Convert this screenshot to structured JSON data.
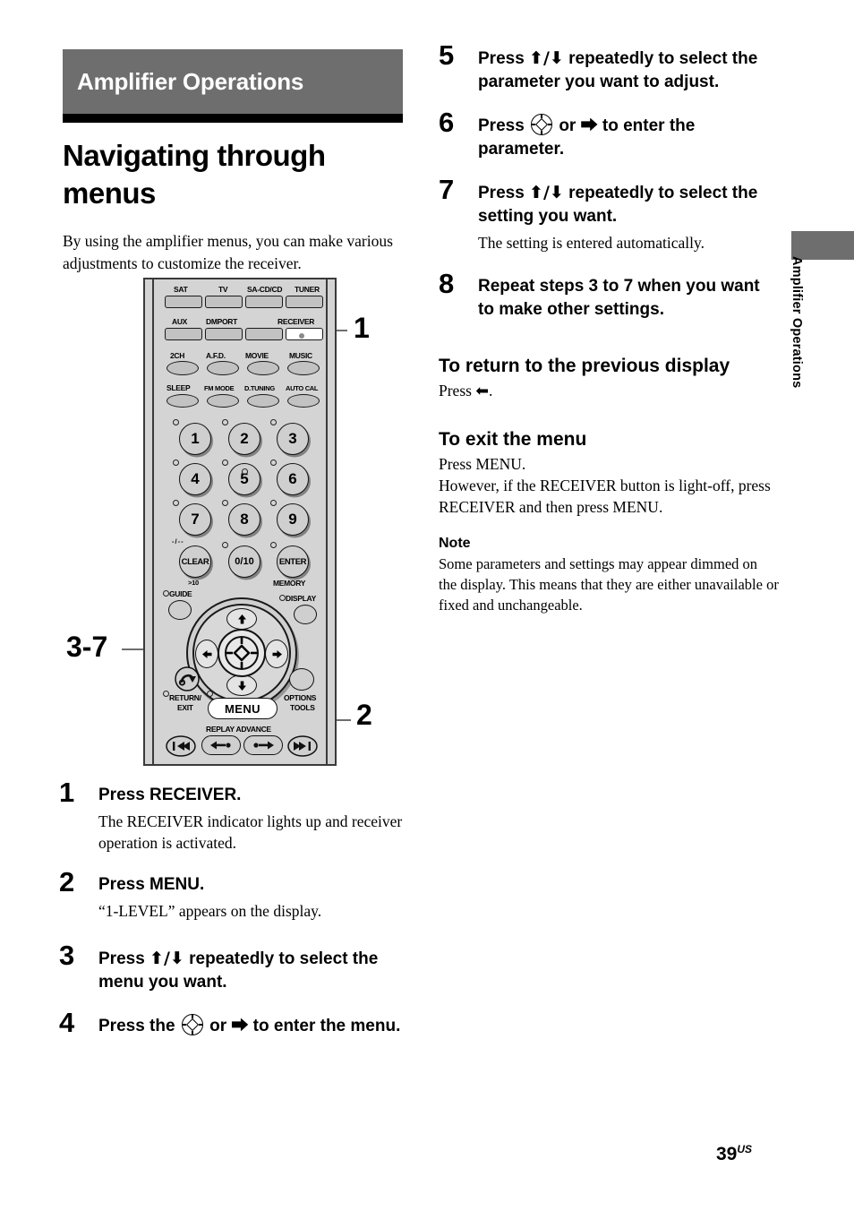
{
  "section": {
    "banner_title": "Amplifier Operations",
    "page_title": "Navigating through menus",
    "intro": "By using the amplifier menus, you can make various adjustments to customize the receiver."
  },
  "remote": {
    "callouts": [
      {
        "label": "1"
      },
      {
        "label": "2"
      },
      {
        "label": "3-7"
      }
    ],
    "input_row_1": [
      "SAT",
      "TV",
      "SA-CD/CD",
      "TUNER"
    ],
    "input_row_2": [
      "AUX",
      "DMPORT",
      "RECEIVER"
    ],
    "mode_row_1": [
      "2CH",
      "A.F.D.",
      "MOVIE",
      "MUSIC"
    ],
    "mode_row_2": [
      "SLEEP",
      "FM MODE",
      "D.TUNING",
      "AUTO CAL"
    ],
    "numeric_keys": [
      "1",
      "2",
      "3",
      "4",
      "5",
      "6",
      "7",
      "8",
      "9"
    ],
    "bottom_keys": [
      "CLEAR",
      "0/10",
      "ENTER"
    ],
    "key_sub_labels": {
      "clear_top": "-/--",
      "clear_bottom": ">10",
      "enter_bottom": "MEMORY"
    },
    "small_buttons": [
      "GUIDE",
      "DISPLAY"
    ],
    "nav_buttons": [
      "RETURN/ EXIT",
      "MENU",
      "OPTIONS TOOLS"
    ],
    "return_exit_line1": "RETURN/",
    "return_exit_line2": "EXIT",
    "options_line1": "OPTIONS",
    "options_line2": "TOOLS",
    "menu_label": "MENU",
    "replay_label": "REPLAY ADVANCE"
  },
  "steps_left": [
    {
      "num": "1",
      "title": "Press RECEIVER.",
      "desc": "The RECEIVER indicator lights up and receiver operation is activated."
    },
    {
      "num": "2",
      "title": "Press MENU.",
      "desc": "“1-LEVEL” appears on the display."
    },
    {
      "num": "3",
      "title_pre": "Press ",
      "title_arrows": "⬆/⬇",
      "title_post": " repeatedly to select the menu you want.",
      "desc": ""
    },
    {
      "num": "4",
      "title_pre": "Press the ",
      "title_post": " or ⮕ to enter the menu.",
      "desc": ""
    }
  ],
  "steps_right": [
    {
      "num": "5",
      "title_pre": "Press ",
      "title_arrows": "⬆/⬇",
      "title_post": " repeatedly to select the parameter you want to adjust.",
      "desc": ""
    },
    {
      "num": "6",
      "title_pre": "Press ",
      "title_post": " or ⮕ to enter the parameter.",
      "desc": ""
    },
    {
      "num": "7",
      "title_pre": "Press ",
      "title_arrows": "⬆/⬇",
      "title_post": " repeatedly to select the setting you want.",
      "desc": "The setting is entered automatically."
    },
    {
      "num": "8",
      "title": "Repeat steps 3 to 7 when you want to make other settings.",
      "desc": ""
    }
  ],
  "right_sections": {
    "return_heading": "To return to the previous display",
    "return_body_pre": "Press ",
    "return_body_post": ".",
    "exit_heading": "To exit the menu",
    "exit_body_line1": "Press MENU.",
    "exit_body_line2": "However, if the RECEIVER button is light-off, press RECEIVER and then press MENU.",
    "note_heading": "Note",
    "note_body": "Some parameters and settings may appear dimmed on the display. This means that they are either unavailable or fixed and unchangeable."
  },
  "side_tab": {
    "text": "Amplifier Operations"
  },
  "footer": {
    "page": "39",
    "region": "US"
  },
  "colors": {
    "banner_gray": "#6e6e6e",
    "rule_black": "#000000",
    "remote_body": "#d4d4d4"
  }
}
